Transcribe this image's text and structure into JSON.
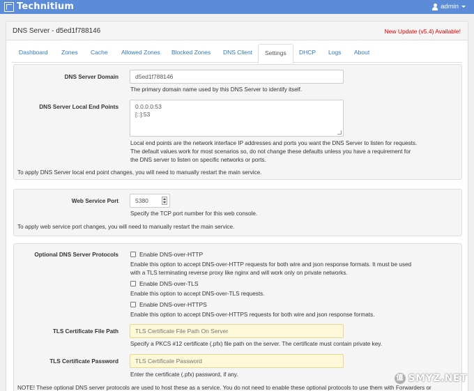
{
  "navbar": {
    "brand": "Technitium",
    "user": "admin"
  },
  "panel": {
    "title": "DNS Server - d5ed1f788146",
    "update": "New Update (v5.4) Available!"
  },
  "tabs": [
    "Dashboard",
    "Zones",
    "Cache",
    "Allowed Zones",
    "Blocked Zones",
    "DNS Client",
    "Settings",
    "DHCP",
    "Logs",
    "About"
  ],
  "active_tab": "Settings",
  "general": {
    "domain_label": "DNS Server Domain",
    "domain_value": "d5ed1f788146",
    "domain_help": "The primary domain name used by this DNS Server to identify itself.",
    "endpoints_label": "DNS Server Local End Points",
    "endpoints_value": "0.0.0.0:53\n[::]:53",
    "endpoints_help_1": "Local end points are the network interface IP addresses and ports you want the DNS Server to listen for requests.",
    "endpoints_help_2": "The default values work for most scenarios so, do not change these defaults unless you have a requirement for",
    "endpoints_help_3": "the DNS server to listen on specific networks or ports.",
    "note": "To apply DNS Server local end point changes, you will need to manually restart the main service."
  },
  "web": {
    "port_label": "Web Service Port",
    "port_value": "5380",
    "port_help": "Specify the TCP port number for this web console.",
    "note": "To apply web service port changes, you will need to manually restart the main service."
  },
  "optional": {
    "protocols_label": "Optional DNS Server Protocols",
    "doh_http": "Enable DNS-over-HTTP",
    "doh_http_help_1": "Enable this option to accept DNS-over-HTTP requests for both wire and json response formats. It must be used",
    "doh_http_help_2": "with a TLS terminating reverse proxy like nginx and will work only on private networks.",
    "dot": "Enable DNS-over-TLS",
    "dot_help": "Enable this option to accept DNS-over-TLS requests.",
    "doh_https": "Enable DNS-over-HTTPS",
    "doh_https_help": "Enable this option to accept DNS-over-HTTPS requests for both wire and json response formats.",
    "cert_path_label": "TLS Certificate File Path",
    "cert_path_placeholder": "TLS Certificate File Path On Server",
    "cert_path_help": "Specify a PKCS #12 certificate (.pfx) file path on the server. The certificate must contain private key.",
    "cert_pass_label": "TLS Certificate Password",
    "cert_pass_placeholder": "TLS Certificate Password",
    "cert_pass_help": "Enter the certificate (.pfx) password, if any.",
    "note": "NOTE! These optional DNS server protocols are used to host these as a service. You do not need to enable these optional protocols to use them with Forwarders or"
  },
  "watermark": {
    "icon": "值",
    "text": "SMYZ.NET"
  }
}
